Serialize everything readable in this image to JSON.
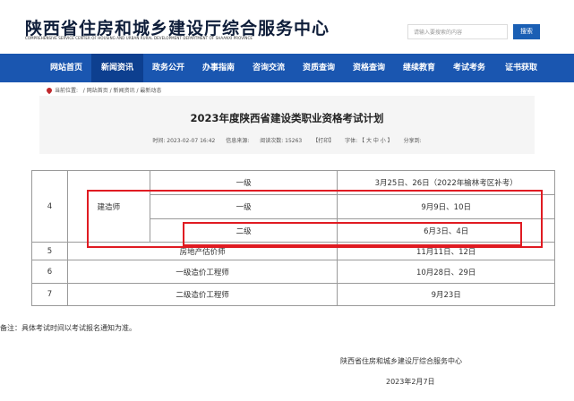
{
  "header": {
    "title": "陕西省住房和城乡建设厅综合服务中心",
    "subtitle": "COMPREHENSIVE SERVICE CENTER OF HOUSING AND URBAN RURAL DEVELOPMENT DEPARTMENT OF SHAANXI PROVINCE",
    "search_placeholder": "请输入要搜索的内容",
    "search_button": "搜索"
  },
  "nav": {
    "items": [
      "网站首页",
      "新闻资讯",
      "政务公开",
      "办事指南",
      "咨询交流",
      "资质查询",
      "资格查询",
      "继续教育",
      "考试考务",
      "证书获取"
    ],
    "active_index": 1
  },
  "breadcrumb": {
    "prefix": "当前位置:",
    "items": [
      "/ 网站首页",
      "/ 新闻资讯",
      "/ 最新动态"
    ]
  },
  "article": {
    "title": "2023年度陕西省建设类职业资格考试计划",
    "time": "时间: 2023-02-07 16:42",
    "source": "信息来源:",
    "views": "阅读次数: 15263",
    "print": "【打印】",
    "font_size": "字体: 【 大  中  小 】",
    "share": "分享到:"
  },
  "table": {
    "rows": [
      {
        "no": "4",
        "name": "建造师",
        "level": "一级",
        "date": "3月25日、26日（2022年榆林考区补考）"
      },
      {
        "no": "",
        "name": "",
        "level": "一级",
        "date": "9月9日、10日"
      },
      {
        "no": "",
        "name": "",
        "level": "二级",
        "date": "6月3日、4日"
      },
      {
        "no": "5",
        "name": "房地产估价师",
        "level": "",
        "date": "11月11日、12日"
      },
      {
        "no": "6",
        "name": "一级造价工程师",
        "level": "",
        "date": "10月28日、29日"
      },
      {
        "no": "7",
        "name": "二级造价工程师",
        "level": "",
        "date": "9月23日"
      }
    ]
  },
  "footer": {
    "note": "备注：具体考试时间以考试报名通知为准。",
    "org": "陕西省住房和城乡建设厅综合服务中心",
    "date": "2023年2月7日"
  },
  "colors": {
    "nav_bg": "#1a56b0",
    "nav_active": "#0d3f8f",
    "highlight": "#e01b22"
  }
}
